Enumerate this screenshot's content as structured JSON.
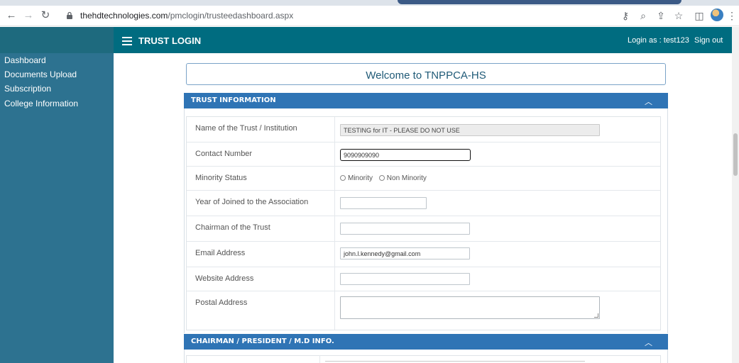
{
  "browser": {
    "url_domain": "thehdtechnologies.com",
    "url_path": "/pmclogin/trusteedashboard.aspx",
    "icons": [
      "back-icon",
      "forward-icon",
      "reload-icon",
      "lock-icon",
      "key-icon",
      "zoom-icon",
      "share-icon",
      "star-icon",
      "sidepanel-icon",
      "profile-avatar",
      "menu-dots-icon"
    ]
  },
  "header": {
    "brand": "TRUST LOGIN",
    "login_as": "Login as : test123",
    "sign_out": "Sign out"
  },
  "sidebar": {
    "items": [
      {
        "label": "Dashboard"
      },
      {
        "label": "Documents Upload"
      },
      {
        "label": "Subscription"
      },
      {
        "label": "College Information"
      }
    ]
  },
  "welcome": "Welcome to TNPPCA-HS",
  "trust_panel": {
    "title": "TRUST INFORMATION",
    "fields": {
      "name": {
        "label": "Name of the Trust / Institution",
        "value": "TESTING for IT - PLEASE DO NOT USE"
      },
      "contact": {
        "label": "Contact Number",
        "value": "9090909090"
      },
      "minority": {
        "label": "Minority Status",
        "option1": "Minority",
        "option2": "Non Minority"
      },
      "year": {
        "label": "Year of Joined to the Association",
        "value": ""
      },
      "chairman": {
        "label": "Chairman of the Trust",
        "value": ""
      },
      "email": {
        "label": "Email Address",
        "value": "john.l.kennedy@gmail.com"
      },
      "website": {
        "label": "Website Address",
        "value": ""
      },
      "postal": {
        "label": "Postal Address",
        "value": ""
      }
    }
  },
  "chairman_panel": {
    "title": "CHAIRMAN / PRESIDENT / M.D INFO."
  },
  "colors": {
    "topbar": "#006c80",
    "sidebar": "#2d7290",
    "panel_header": "#2f74b5"
  }
}
